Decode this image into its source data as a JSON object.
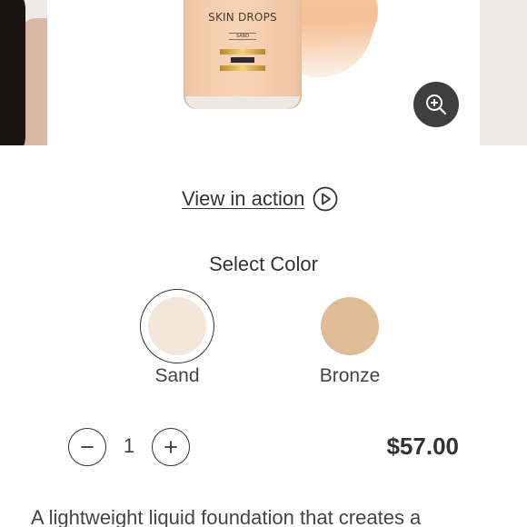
{
  "product_image": {
    "brand_text": "SKIN DROPS",
    "shade_text": "SAND",
    "zoom_icon": "zoom-in-icon"
  },
  "view_in_action": {
    "label": "View in action",
    "icon": "play-circle-icon"
  },
  "color_selector": {
    "title": "Select Color",
    "options": [
      {
        "name": "Sand",
        "color": "#f5e6da",
        "selected": true
      },
      {
        "name": "Bronze",
        "color": "#e0bc96",
        "selected": false
      }
    ]
  },
  "quantity": {
    "value": "1",
    "decrement_icon": "minus-circle-icon",
    "increment_icon": "plus-circle-icon"
  },
  "price": "$57.00",
  "description": "A lightweight liquid foundation that creates a"
}
